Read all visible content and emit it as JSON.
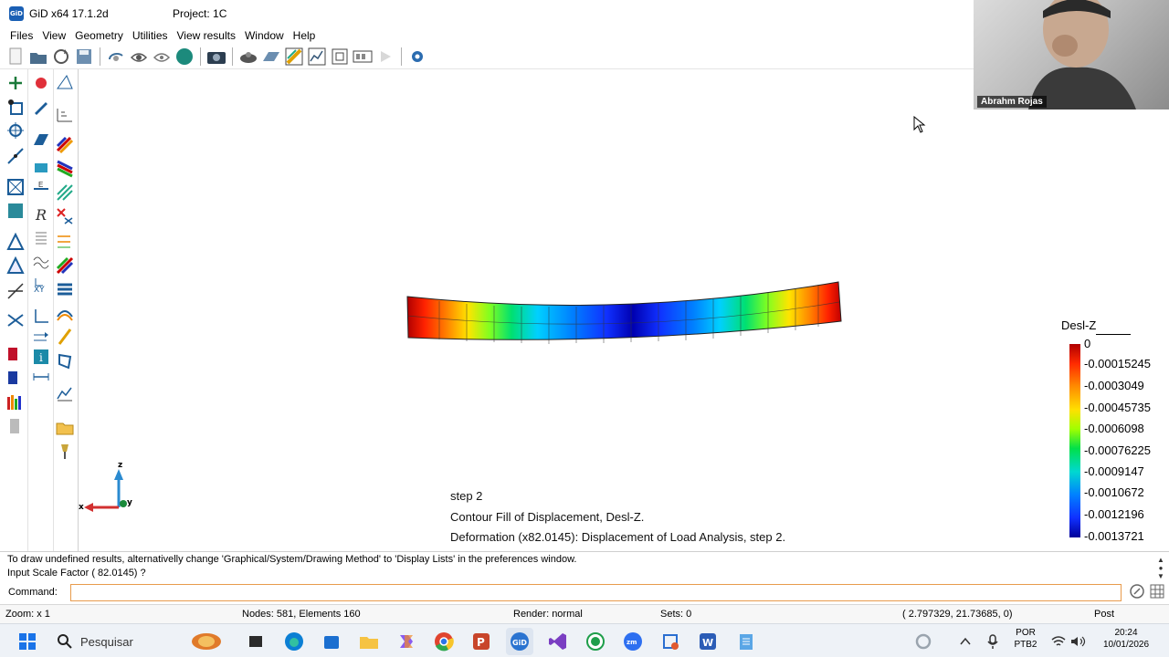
{
  "window": {
    "app_title": "GiD x64 17.1.2d",
    "project_title": "Project: 1C",
    "app_icon_text": "GiD"
  },
  "menu": [
    "Files",
    "View",
    "Geometry",
    "Utilities",
    "View results",
    "Window",
    "Help"
  ],
  "viewport": {
    "step_line": "step 2",
    "contour_line": "Contour Fill of Displacement, Desl-Z.",
    "deformation_line": "Deformation (x82.0145): Displacement of Load Analysis, step 2."
  },
  "legend": {
    "title": "Desl-Z",
    "labels": [
      "0",
      "-0.00015245",
      "-0.0003049",
      "-0.00045735",
      "-0.0006098",
      "-0.00076225",
      "-0.0009147",
      "-0.0010672",
      "-0.0012196",
      "-0.0013721"
    ]
  },
  "axes": {
    "x": "x",
    "y": "y",
    "z": "z"
  },
  "messages": {
    "line1": "To draw undefined results, alternativelly change 'Graphical/System/Drawing Method' to 'Display Lists' in the preferences window.",
    "line2": "Input Scale Factor ( 82.0145) ?"
  },
  "command": {
    "label": "Command:",
    "value": ""
  },
  "status": {
    "zoom": "Zoom: x 1",
    "mesh": "Nodes: 581, Elements 160",
    "render": "Render: normal",
    "sets": "Sets: 0",
    "coords": "( 2.797329, 21.73685, 0)",
    "mode": "Post"
  },
  "webcam": {
    "name": "Abrahm Rojas"
  },
  "taskbar": {
    "search_placeholder": "Pesquisar",
    "lang_top": "POR",
    "lang_bottom": "PTB2",
    "time": "20:24",
    "date": "10/01/2026"
  },
  "colors": {
    "accent": "#1a5fb4",
    "command_border": "#e89b4c",
    "taskbar": "#eef2f7"
  }
}
